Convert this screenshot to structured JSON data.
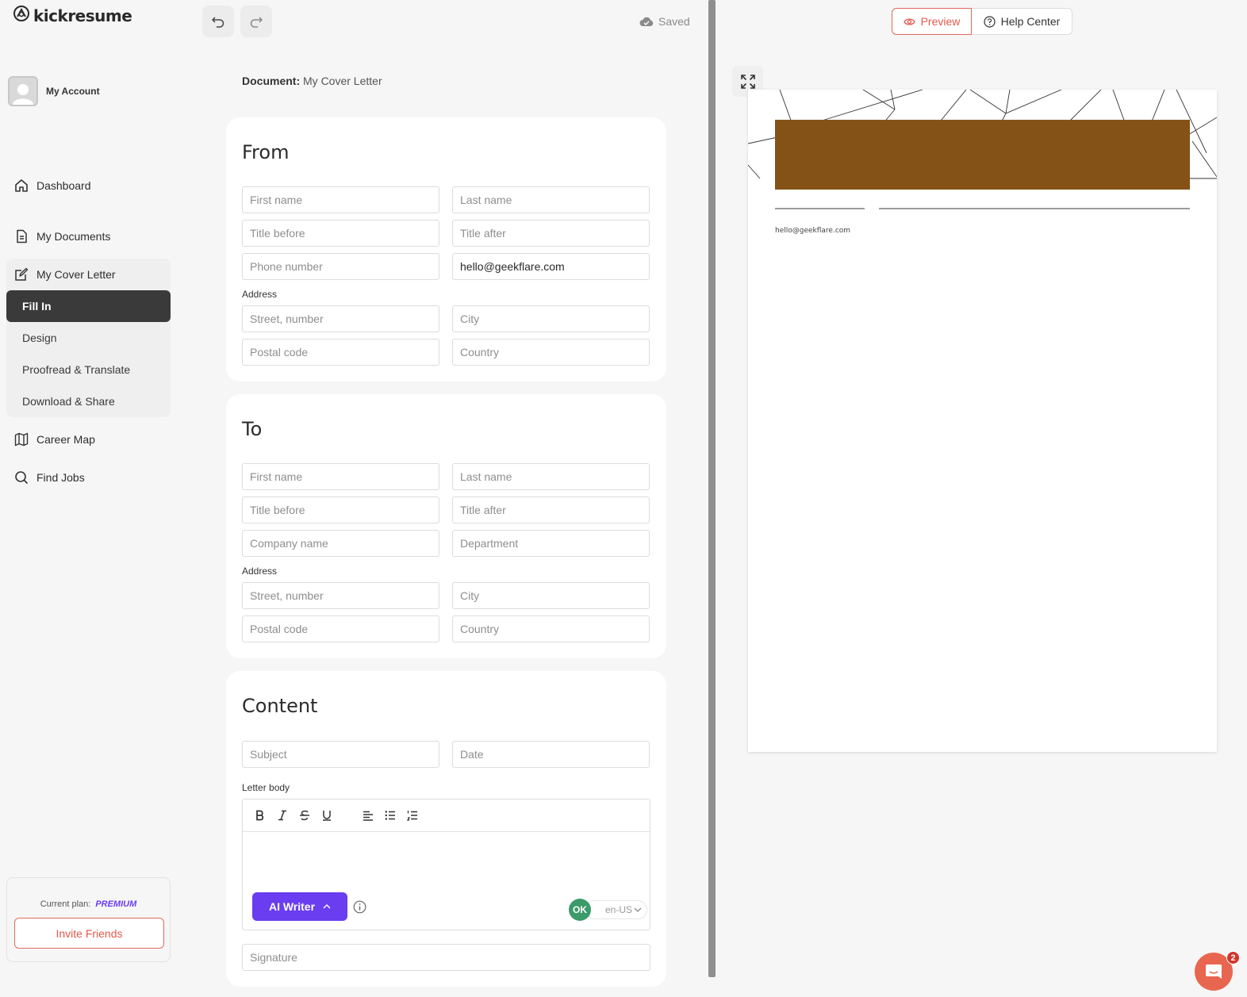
{
  "brand": {
    "name": "kickresume"
  },
  "account": {
    "label": "My Account"
  },
  "nav": {
    "dashboard": "Dashboard",
    "my_documents": "My Documents",
    "my_cover_letter": "My Cover Letter",
    "sub": {
      "fill_in": "Fill In",
      "design": "Design",
      "proofread": "Proofread & Translate",
      "download": "Download & Share"
    },
    "career_map": "Career Map",
    "find_jobs": "Find Jobs"
  },
  "plan": {
    "label": "Current plan:",
    "value": "PREMIUM",
    "invite": "Invite Friends"
  },
  "toolbar": {
    "saved": "Saved"
  },
  "document": {
    "label": "Document:",
    "name": "My Cover Letter"
  },
  "from": {
    "title": "From",
    "first_name": "First name",
    "last_name": "Last name",
    "title_before": "Title before",
    "title_after": "Title after",
    "phone": "Phone number",
    "email_value": "hello@geekflare.com",
    "address_label": "Address",
    "street": "Street, number",
    "city": "City",
    "postal": "Postal code",
    "country": "Country"
  },
  "to": {
    "title": "To",
    "first_name": "First name",
    "last_name": "Last name",
    "title_before": "Title before",
    "title_after": "Title after",
    "company": "Company name",
    "department": "Department",
    "address_label": "Address",
    "street": "Street, number",
    "city": "City",
    "postal": "Postal code",
    "country": "Country"
  },
  "content": {
    "title": "Content",
    "subject": "Subject",
    "date": "Date",
    "body_label": "Letter body",
    "ai_writer": "AI Writer",
    "ok": "OK",
    "lang": "en-US",
    "signature": "Signature"
  },
  "preview": {
    "preview_btn": "Preview",
    "help_btn": "Help Center",
    "email": "hello@geekflare.com",
    "header_color": "#845217"
  },
  "chat": {
    "badge": "2"
  },
  "colors": {
    "accent": "#e4574a",
    "ai": "#6a3df0",
    "premium": "#6c3cf0"
  }
}
